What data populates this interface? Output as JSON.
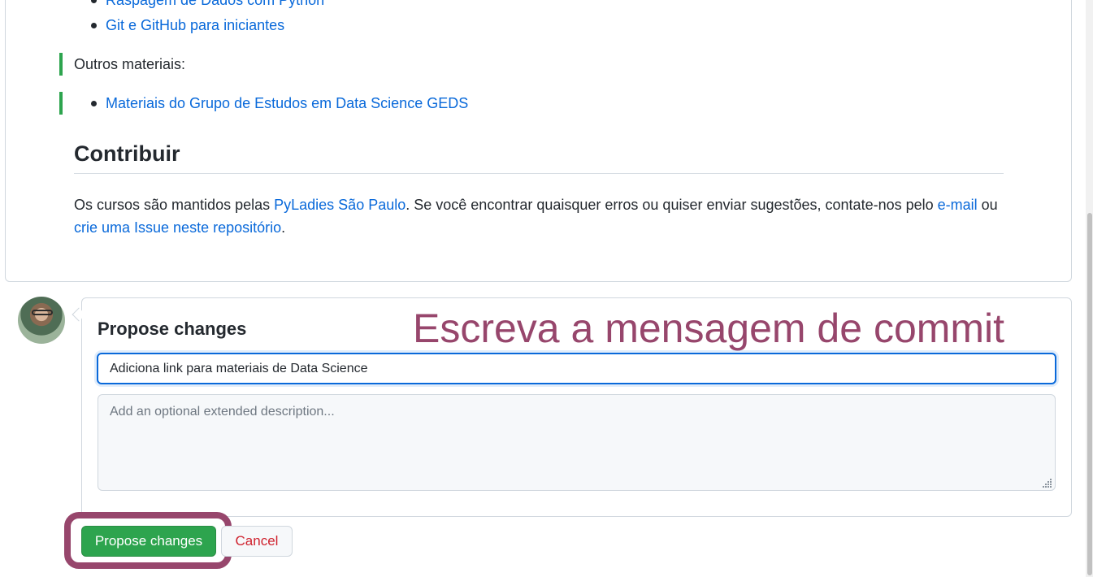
{
  "readme": {
    "course_links": [
      "Raspagem de Dados com Python",
      "Git e GitHub para iniciantes"
    ],
    "other_materials_label": "Outros materiais:",
    "other_material_links": [
      "Materiais do Grupo de Estudos em Data Science GEDS"
    ],
    "contribute_heading": "Contribuir",
    "contribute_paragraph": {
      "text_1": "Os cursos são mantidos pelas ",
      "link_pyladies": "PyLadies São Paulo",
      "text_2": ". Se você encontrar quaisquer erros ou quiser enviar sugestões, contate-nos pelo ",
      "link_email": "e-mail",
      "text_3": " ou ",
      "link_issue": "crie uma Issue neste repositório",
      "text_4": "."
    }
  },
  "commit": {
    "title": "Propose changes",
    "message_value": "Adiciona link para materiais de Data Science",
    "description_placeholder": "Add an optional extended description...",
    "submit_label": "Propose changes",
    "cancel_label": "Cancel"
  },
  "annotation": {
    "text": "Escreva a mensagem de commit",
    "color": "#97466c"
  },
  "colors": {
    "link": "#0969da",
    "added_line": "#2da44e",
    "primary_button": "#2da44e",
    "cancel_text": "#cf222e"
  },
  "icons": {
    "avatar": "user-avatar",
    "resize": "resize-grip-icon"
  }
}
